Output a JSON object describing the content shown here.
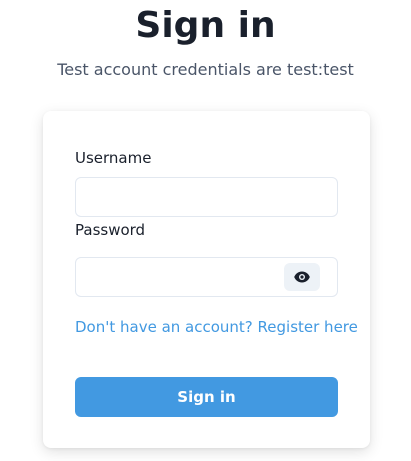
{
  "header": {
    "title": "Sign in",
    "subtitle": "Test account credentials are test:test"
  },
  "form": {
    "username_label": "Username",
    "username_value": "",
    "password_label": "Password",
    "password_value": "",
    "show_password_icon": "eye-icon",
    "register_link": "Don't have an account? Register here",
    "submit_label": "Sign in"
  },
  "colors": {
    "accent": "#4299e1",
    "text": "#1a202c",
    "muted": "#4a5568",
    "border": "#e2e8f0",
    "icon_button_bg": "#edf2f7"
  }
}
